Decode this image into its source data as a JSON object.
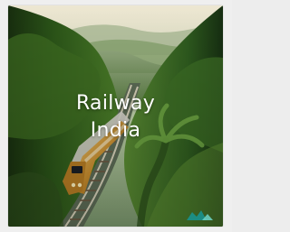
{
  "card": {
    "title_line_1": "Railway",
    "title_line_2": "India",
    "brand_mark_icon": "mountain-logo-icon"
  }
}
